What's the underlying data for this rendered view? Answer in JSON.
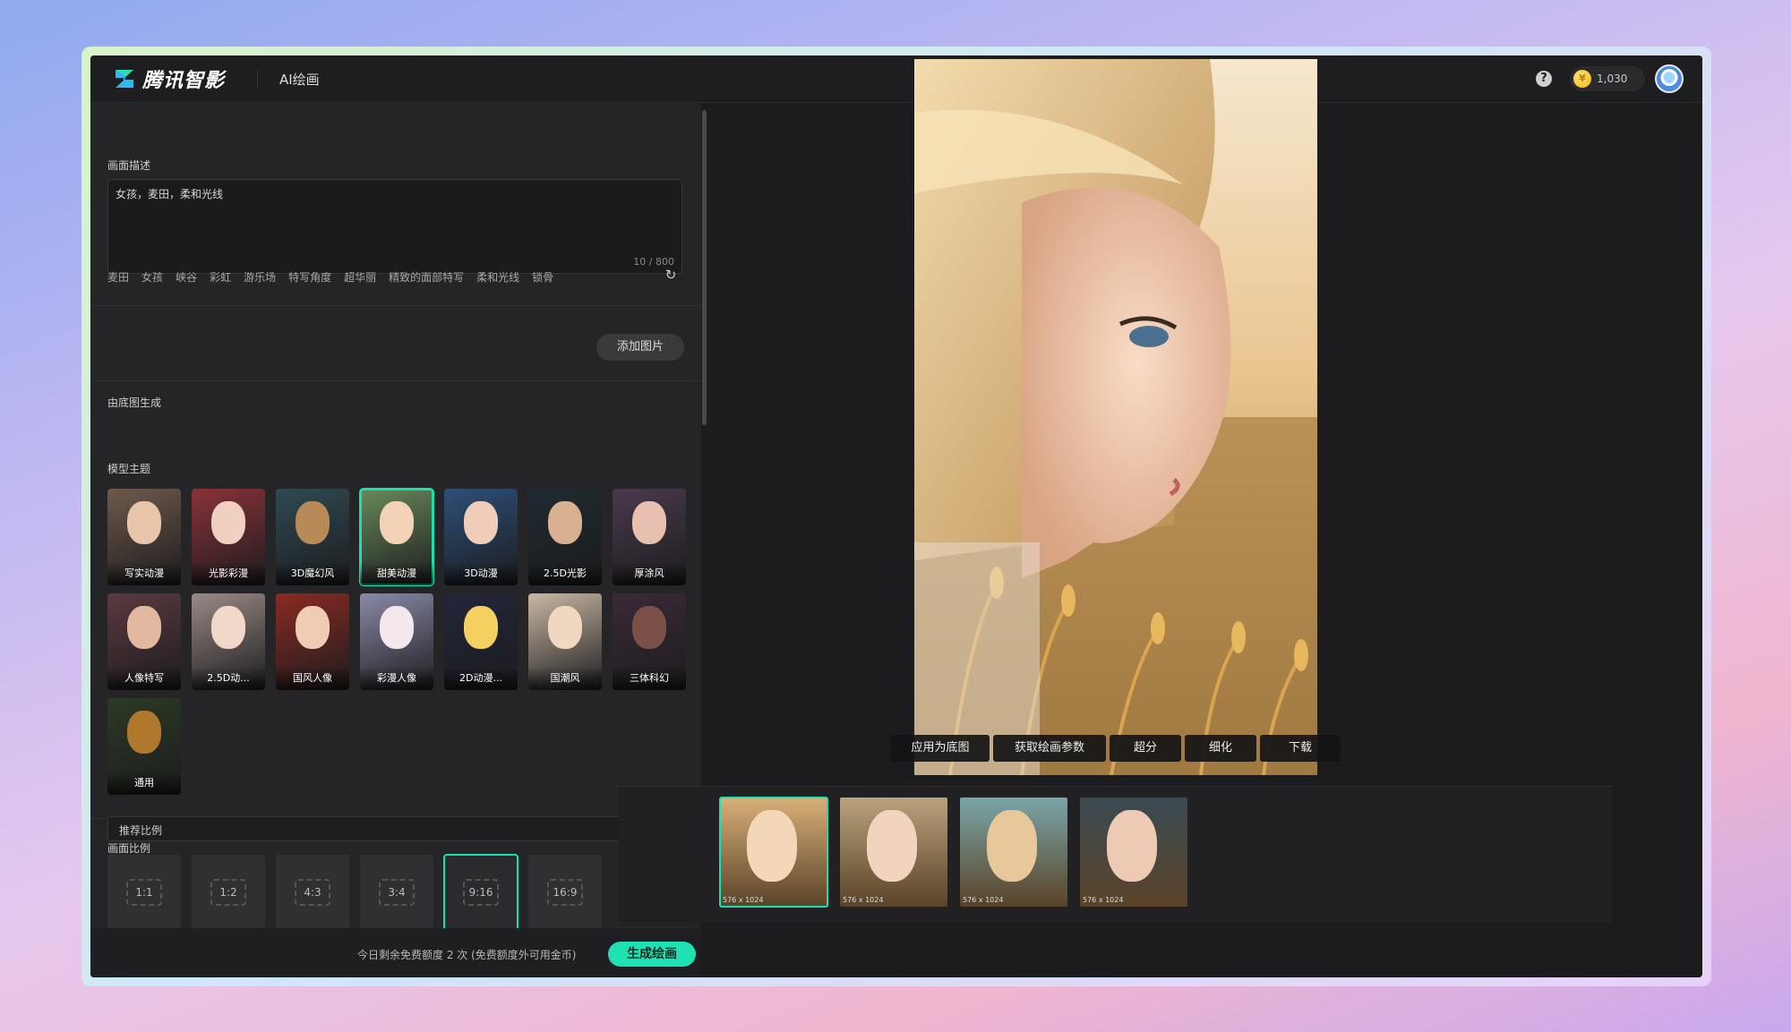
{
  "header": {
    "brand": "腾讯智影",
    "page": "AI绘画",
    "coins": "1,030",
    "icons": {
      "logo": "zhiying-logo-icon",
      "help": "question-icon",
      "coin": "gold-coin-icon",
      "avatar": "user-avatar"
    }
  },
  "prompt": {
    "title": "画面描述",
    "value": "女孩，麦田，柔和光线",
    "count": "10 / 800",
    "chips": [
      "麦田",
      "女孩",
      "峡谷",
      "彩虹",
      "游乐场",
      "特写角度",
      "超华丽",
      "精致的面部特写",
      "柔和光线",
      "锁骨"
    ]
  },
  "base_image": {
    "title": "由底图生成",
    "button": "添加图片"
  },
  "models": {
    "title": "模型主题",
    "items": [
      {
        "label": "写实动漫",
        "bg": "#6e5a4c",
        "face": "#e8c4aa"
      },
      {
        "label": "光影彩漫",
        "bg": "#8a3238",
        "face": "#f0d0c0"
      },
      {
        "label": "3D魔幻风",
        "bg": "#2f4a52",
        "face": "#b88a58"
      },
      {
        "label": "甜美动漫",
        "bg": "#6a8a5a",
        "face": "#f3d2b8"
      },
      {
        "label": "3D动漫",
        "bg": "#2d4f78",
        "face": "#f0cdb8"
      },
      {
        "label": "2.5D光影",
        "bg": "#1e2a30",
        "face": "#d9b090"
      },
      {
        "label": "厚涂风",
        "bg": "#4a3a4c",
        "face": "#e8c0b0"
      },
      {
        "label": "人像特写",
        "bg": "#5a3a40",
        "face": "#e2b8a0"
      },
      {
        "label": "2.5D动...",
        "bg": "#9a8a86",
        "face": "#f2d8c8"
      },
      {
        "label": "国风人像",
        "bg": "#8a2a22",
        "face": "#f0ccb4"
      },
      {
        "label": "彩漫人像",
        "bg": "#8a8aa8",
        "face": "#f4e8ec"
      },
      {
        "label": "2D动漫...",
        "bg": "#22263a",
        "face": "#f4d060"
      },
      {
        "label": "国潮风",
        "bg": "#c9b8a4",
        "face": "#f0d8c0"
      },
      {
        "label": "三体科幻",
        "bg": "#3a2a38",
        "face": "#7a5048"
      },
      {
        "label": "通用",
        "bg": "#2c3a24",
        "face": "#b0782c"
      }
    ]
  },
  "ratio": {
    "title": "画面比例",
    "select": "推荐比例",
    "options": [
      "1:1",
      "1:2",
      "4:3",
      "3:4",
      "9:16",
      "16:9"
    ],
    "selected": "9:16"
  },
  "footer": {
    "quota": "今日剩余免费额度 2 次 (免费额度外可用金币)",
    "generate": "生成绘画"
  },
  "actions": [
    "应用为底图",
    "获取绘画参数",
    "超分",
    "细化",
    "下载"
  ],
  "thumbnails": [
    {
      "res": "576 x 1024",
      "selected": true
    },
    {
      "res": "576 x 1024",
      "selected": false
    },
    {
      "res": "576 x 1024",
      "selected": false
    },
    {
      "res": "576 x 1024",
      "selected": false
    }
  ],
  "colors": {
    "accent": "#1fe2b4",
    "panel": "#252527",
    "bg": "#1c1c1e"
  }
}
